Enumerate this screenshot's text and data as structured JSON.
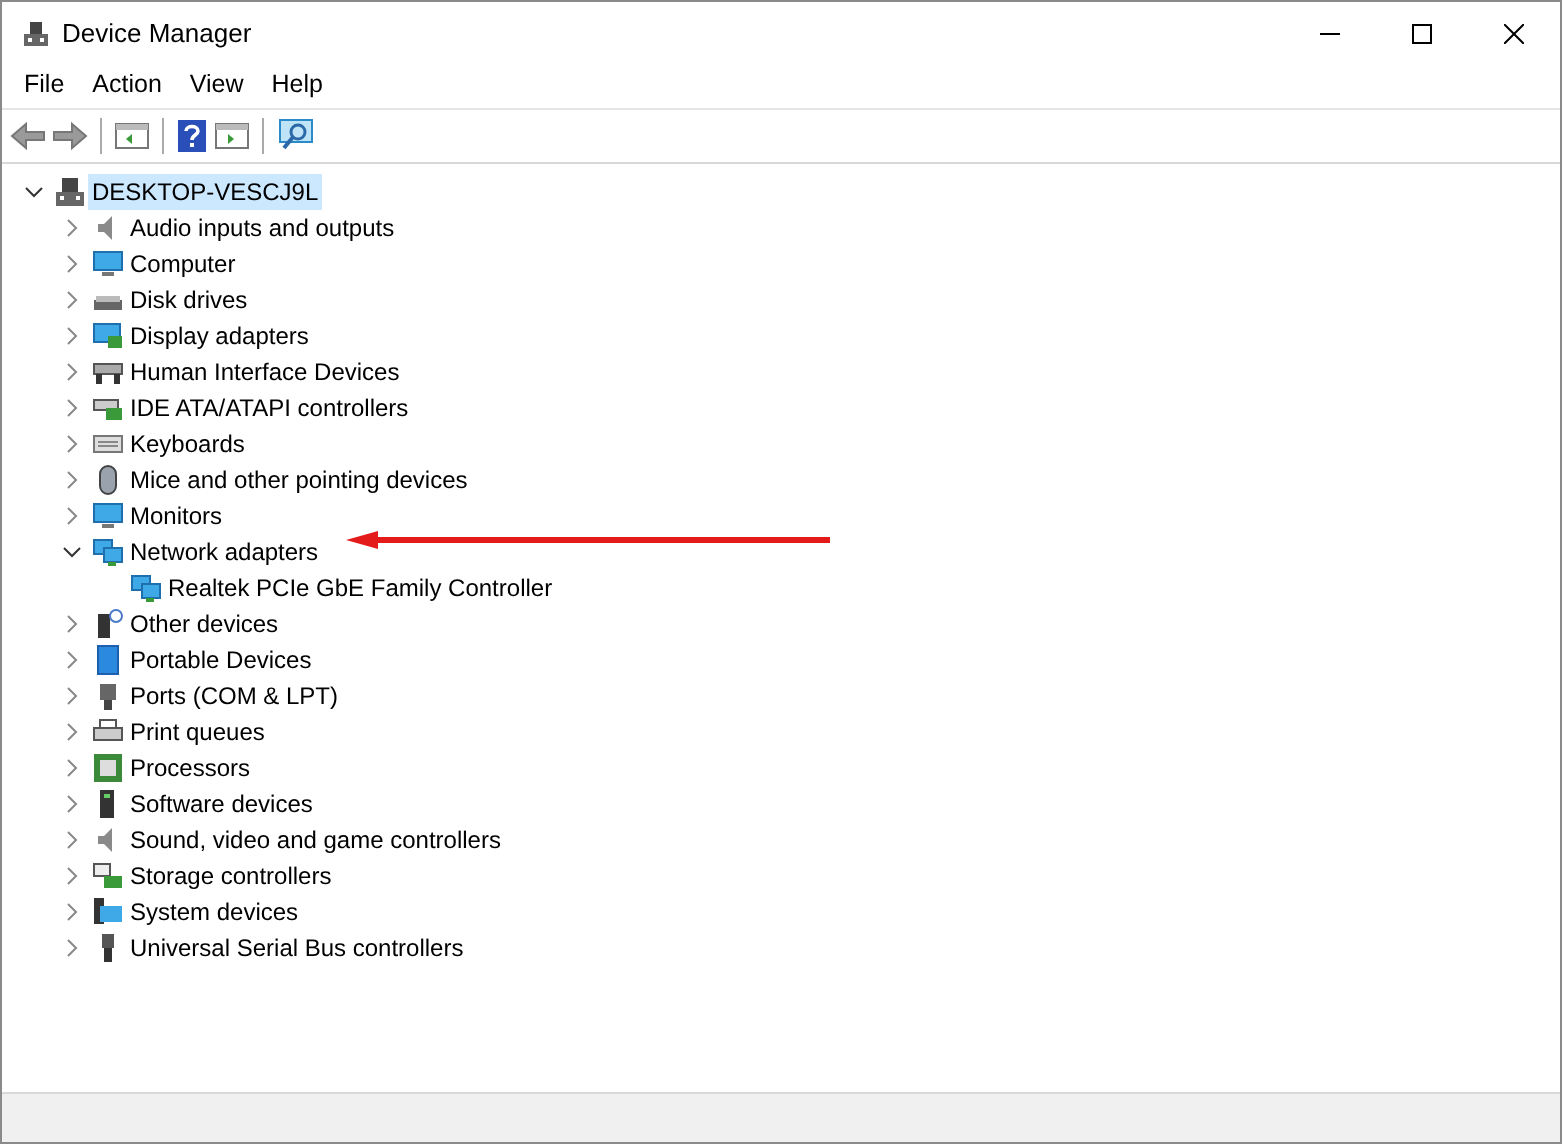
{
  "window": {
    "title": "Device Manager"
  },
  "menu": [
    "File",
    "Action",
    "View",
    "Help"
  ],
  "tree": [
    {
      "label": "DESKTOP-VESCJ9L",
      "expanded": true,
      "selected": true,
      "children": [
        {
          "label": "Audio inputs and outputs",
          "expanded": false,
          "selected": false
        },
        {
          "label": "Computer",
          "expanded": false,
          "selected": false
        },
        {
          "label": "Disk drives",
          "expanded": false,
          "selected": false
        },
        {
          "label": "Display adapters",
          "expanded": false,
          "selected": false
        },
        {
          "label": "Human Interface Devices",
          "expanded": false,
          "selected": false
        },
        {
          "label": "IDE ATA/ATAPI controllers",
          "expanded": false,
          "selected": false
        },
        {
          "label": "Keyboards",
          "expanded": false,
          "selected": false
        },
        {
          "label": "Mice and other pointing devices",
          "expanded": false,
          "selected": false
        },
        {
          "label": "Monitors",
          "expanded": false,
          "selected": false
        },
        {
          "label": "Network adapters",
          "expanded": true,
          "selected": false,
          "children": [
            {
              "label": "Realtek PCIe GbE Family Controller",
              "selected": false
            }
          ]
        },
        {
          "label": "Other devices",
          "expanded": false,
          "selected": false
        },
        {
          "label": "Portable Devices",
          "expanded": false,
          "selected": false
        },
        {
          "label": "Ports (COM & LPT)",
          "expanded": false,
          "selected": false
        },
        {
          "label": "Print queues",
          "expanded": false,
          "selected": false
        },
        {
          "label": "Processors",
          "expanded": false,
          "selected": false
        },
        {
          "label": "Software devices",
          "expanded": false,
          "selected": false
        },
        {
          "label": "Sound, video and game controllers",
          "expanded": false,
          "selected": false
        },
        {
          "label": "Storage controllers",
          "expanded": false,
          "selected": false
        },
        {
          "label": "System devices",
          "expanded": false,
          "selected": false
        },
        {
          "label": "Universal Serial Bus controllers",
          "expanded": false,
          "selected": false
        }
      ]
    }
  ]
}
